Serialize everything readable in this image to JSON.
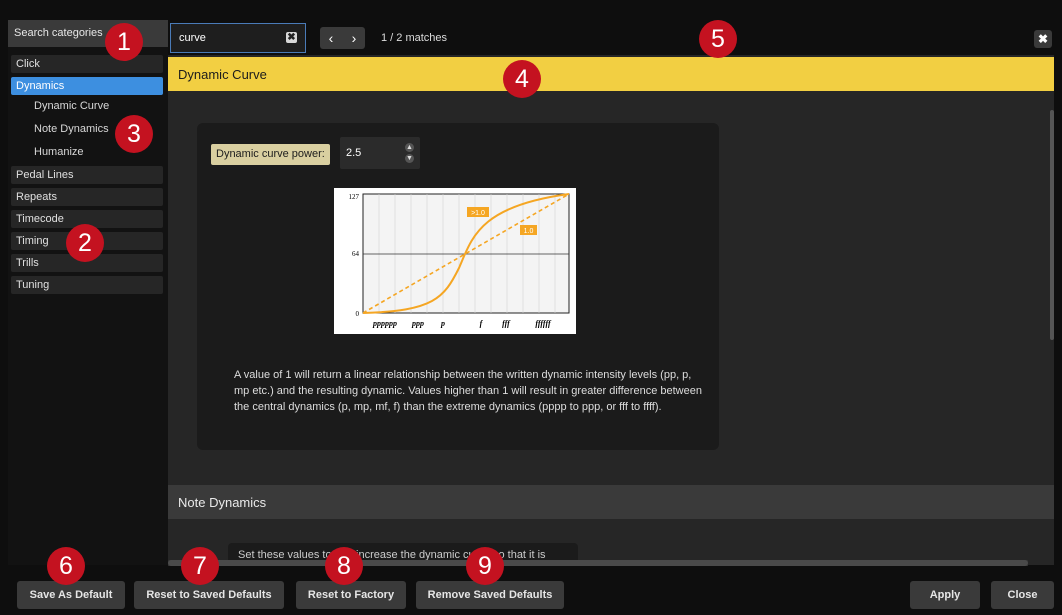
{
  "sidebar": {
    "search_label": "Search categories",
    "categories": [
      {
        "label": "Click"
      },
      {
        "label": "Dynamics"
      },
      {
        "label": "Pedal Lines"
      },
      {
        "label": "Repeats"
      },
      {
        "label": "Timecode"
      },
      {
        "label": "Timing"
      },
      {
        "label": "Trills"
      },
      {
        "label": "Tuning"
      }
    ],
    "subitems": [
      {
        "label": "Dynamic Curve"
      },
      {
        "label": "Note Dynamics"
      },
      {
        "label": "Humanize"
      }
    ],
    "selected": "Dynamics"
  },
  "find": {
    "value": "curve",
    "clear_glyph": "✖",
    "prev_glyph": "‹",
    "next_glyph": "›",
    "matches": "1 / 2 matches",
    "close_glyph": "✖"
  },
  "main": {
    "section_title": "Dynamic Curve",
    "power_label": "Dynamic curve power:",
    "power_value": "2.5",
    "curve": {
      "y_ticks": [
        "127",
        "64",
        "0"
      ],
      "x_ticks": [
        "pppppp",
        "ppp",
        "p",
        "f",
        "fff",
        "ffffff"
      ],
      "tag_high": ">1.0",
      "tag_linear": "1.0"
    },
    "description": "A value of 1 will return a linear relationship between the written dynamic intensity levels (pp, p, mp etc.) and the resulting dynamic. Values higher than 1 will result in greater difference between the central dynamics (p, mp, mf, f) than the extreme dynamics (pppp to ppp, or fff to ffff).",
    "section2_title": "Note Dynamics",
    "section2_partial": "Set these values to 1 to increase the dynamic curve so that it is"
  },
  "footer": {
    "save_default": "Save As Default",
    "reset_saved": "Reset to Saved Defaults",
    "reset_factory": "Reset to Factory",
    "remove_saved": "Remove Saved Defaults",
    "apply": "Apply",
    "close": "Close"
  },
  "callouts": [
    "1",
    "2",
    "3",
    "4",
    "5",
    "6",
    "7",
    "8",
    "9"
  ],
  "colors": {
    "selection": "#3d8fe0",
    "section_highlight": "#f2cf42",
    "callout": "#c41220",
    "curve": "#f5a623"
  }
}
